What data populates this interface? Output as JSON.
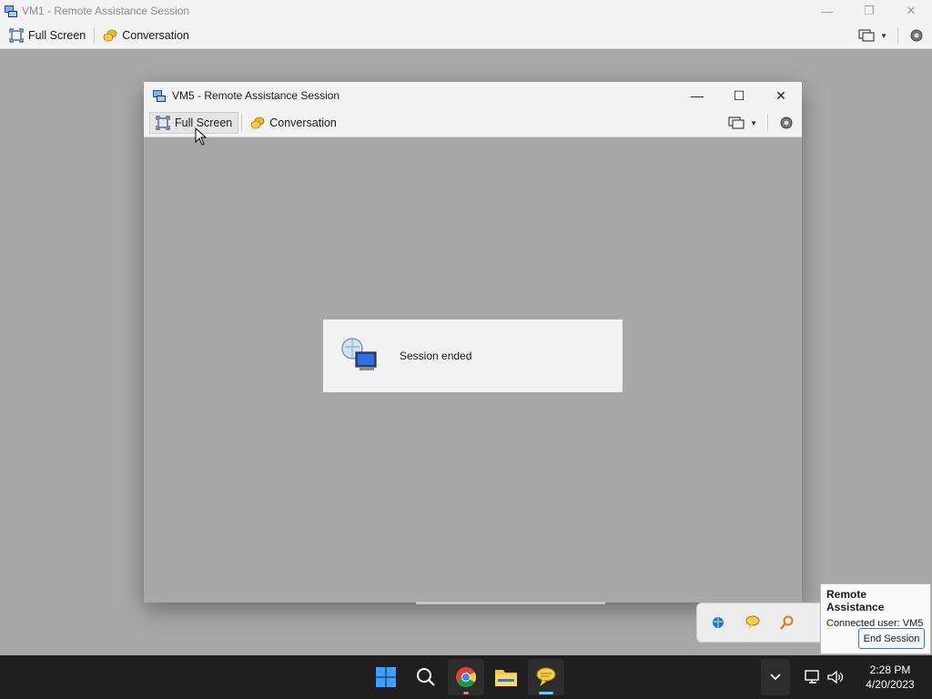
{
  "outer_window": {
    "title": "VM1 - Remote Assistance Session",
    "toolbar": {
      "full_screen_label": "Full Screen",
      "conversation_label": "Conversation"
    }
  },
  "inner_window": {
    "title": "VM5 - Remote Assistance Session",
    "toolbar": {
      "full_screen_label": "Full Screen",
      "conversation_label": "Conversation"
    },
    "dialog": {
      "message": "Session ended"
    }
  },
  "remote_assistance_popup": {
    "title": "Remote Assistance",
    "connected_user_label": "Connected user:  VM5",
    "end_session_label": "End Session"
  },
  "taskbar": {
    "time": "2:28 PM",
    "date": "4/20/2023"
  },
  "icons": {
    "accent": "#0a74da",
    "active_indicator": "#60cdff"
  }
}
